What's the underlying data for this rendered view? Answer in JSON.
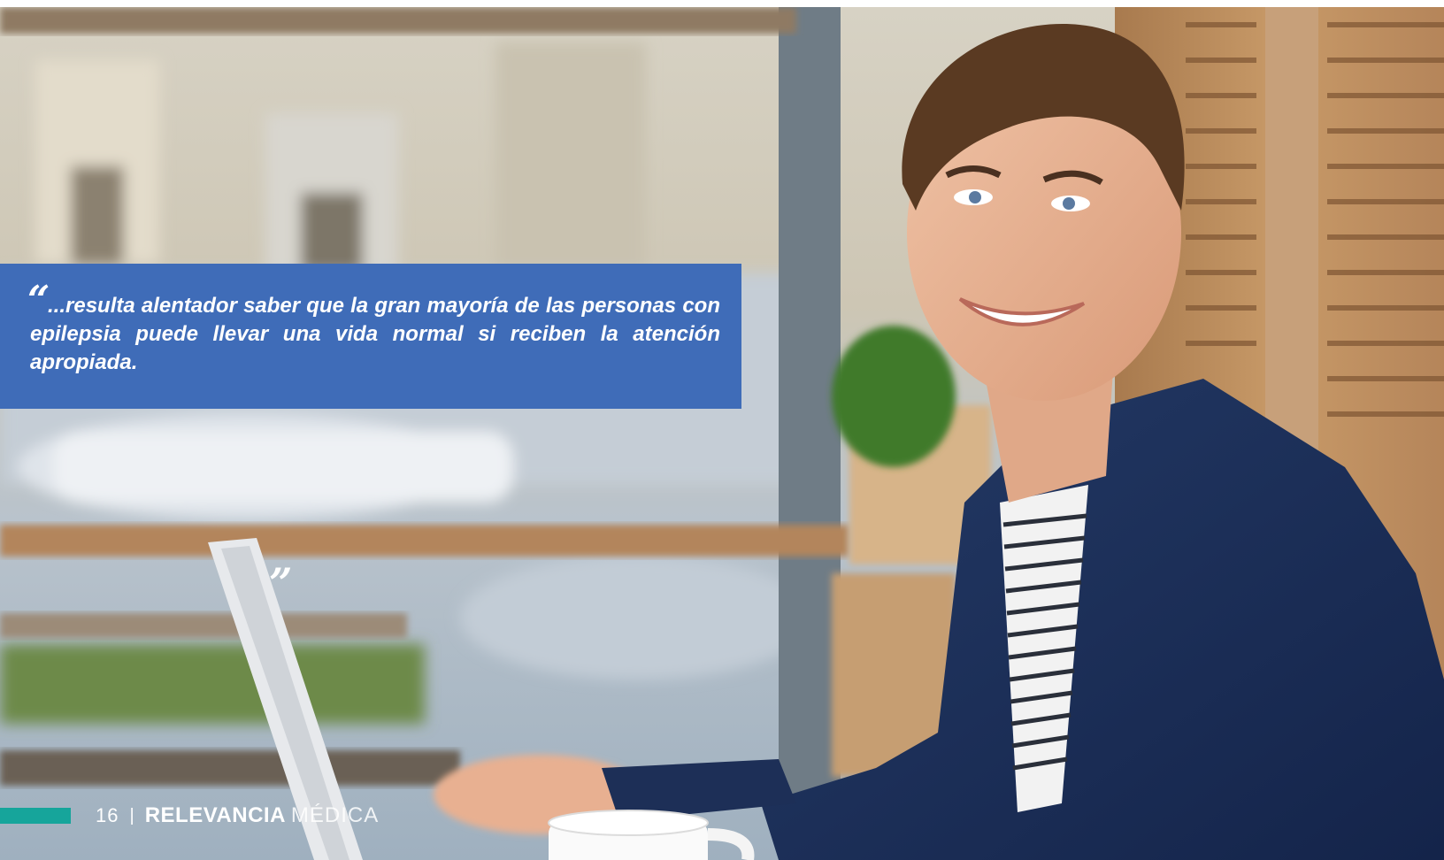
{
  "quote": {
    "open_mark": "“",
    "text": "...resulta alentador saber que la gran mayoría de las personas con epilepsia puede llevar una vida normal si reciben la atención apropiada.",
    "close_mark": "”"
  },
  "footer": {
    "page_number": "16",
    "separator": "|",
    "brand_bold": "RELEVANCIA",
    "brand_light": "MÉDICA"
  },
  "colors": {
    "quote_background": "#3f6cb8",
    "accent_bar": "#16a59b",
    "text": "#ffffff"
  }
}
